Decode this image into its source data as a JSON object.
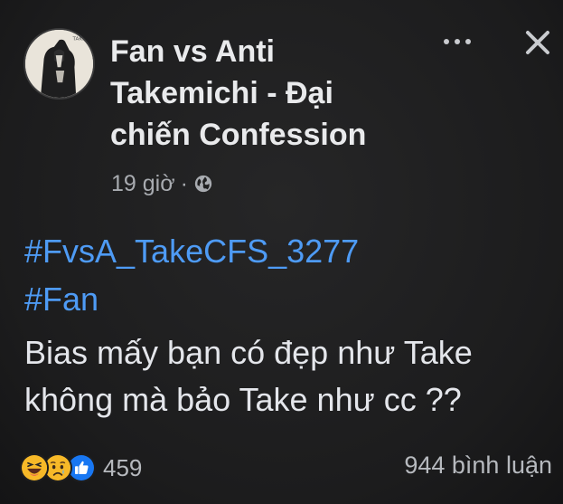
{
  "post": {
    "page_name": "Fan vs Anti Takemichi - Đại chiến Confession",
    "time": "19 giờ",
    "separator": "·",
    "visibility_icon": "globe-icon",
    "hashtags": [
      "#FvsA_TakeCFS_3277",
      "#Fan"
    ],
    "body_lines": [
      "Bias mấy bạn có đẹp như Take",
      "không mà bảo Take như cc ??"
    ]
  },
  "header_actions": {
    "more_icon": "more-horizontal-icon",
    "close_icon": "close-icon"
  },
  "footer": {
    "reaction_icons": [
      "haha-icon",
      "sad-icon",
      "like-icon"
    ],
    "reaction_count": "459",
    "comment_count": "944 bình luận"
  },
  "colors": {
    "background": "#1b1b1c",
    "hashtag": "#4e9bf5",
    "text": "#e4e6eb",
    "muted": "#a8abb0",
    "like": "#1877f2",
    "emoji": "#f7b928"
  }
}
